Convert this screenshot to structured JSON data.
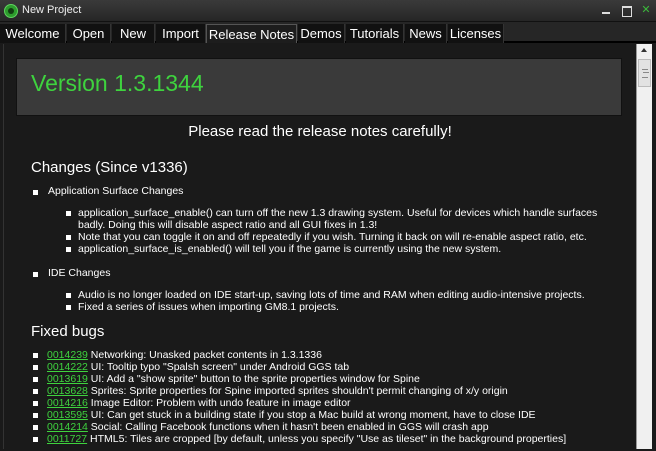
{
  "window": {
    "title": "New Project"
  },
  "tabs": [
    {
      "label": "Welcome"
    },
    {
      "label": "Open"
    },
    {
      "label": "New"
    },
    {
      "label": "Import"
    },
    {
      "label": "Release Notes",
      "active": true
    },
    {
      "label": "Demos"
    },
    {
      "label": "Tutorials"
    },
    {
      "label": "News"
    },
    {
      "label": "Licenses"
    }
  ],
  "notes": {
    "version": "Version 1.3.1344",
    "notice": "Please read the release notes carefully!",
    "changes_title": "Changes (Since v1336)",
    "app_surface_title": "Application Surface Changes",
    "app_surface_items": [
      "application_surface_enable() can turn off the new 1.3 drawing system. Useful for devices which handle surfaces",
      "badly. Doing this will disable aspect ratio and all GUI fixes in 1.3!",
      "Note that you can toggle it on and off repeatedly if you wish. Turning it back on will re-enable aspect ratio, etc.",
      "application_surface_is_enabled() will tell you if the game is currently using the new system."
    ],
    "ide_title": "IDE Changes",
    "ide_items": [
      "Audio is no longer loaded on IDE start-up, saving lots of time and RAM when editing audio-intensive projects.",
      "Fixed a series of issues when importing GM8.1 projects."
    ],
    "fixed_title": "Fixed bugs",
    "bugs": [
      {
        "id": "0014239",
        "text": " Networking: Unasked packet contents in 1.3.1336"
      },
      {
        "id": "0014222",
        "text": " UI: Tooltip typo \"Spalsh screen\" under Android GGS tab"
      },
      {
        "id": "0013619",
        "text": " UI: Add a \"show sprite\" button to the sprite properties window for Spine"
      },
      {
        "id": "0013628",
        "text": " Sprites: Sprite properties for Spine imported sprites shouldn't permit changing of x/y origin"
      },
      {
        "id": "0014216",
        "text": " Image Editor: Problem with undo feature in image editor"
      },
      {
        "id": "0013595",
        "text": " UI: Can get stuck in a building state if you stop a Mac build at wrong moment, have to close IDE"
      },
      {
        "id": "0014214",
        "text": " Social: Calling Facebook functions when it hasn't been enabled in GGS will crash app"
      },
      {
        "id": "0011727",
        "text": " HTML5: Tiles are cropped [by default, unless you specify \"Use as tileset\" in the background properties]"
      }
    ]
  },
  "colors": {
    "accent": "#3ed33e",
    "background": "#1a1a1a",
    "version_box": "#3a3a3a"
  }
}
